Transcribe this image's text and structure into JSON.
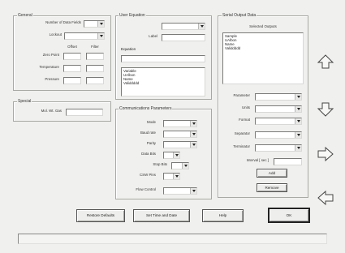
{
  "general": {
    "title": "General",
    "num_data_fields_label": "Number of Data Fields",
    "num_data_fields_value": "",
    "lockout_label": "Lockout",
    "lockout_value": "",
    "offset_header": "Offset",
    "filter_header": "Filter",
    "rows": [
      {
        "label": "Zero Point"
      },
      {
        "label": "Temperature"
      },
      {
        "label": "Pressure"
      }
    ]
  },
  "special": {
    "title": "Special",
    "mol_wt_label": "Mol. Wt. Gas",
    "mol_wt_value": ""
  },
  "user_equation": {
    "title": "User Equation",
    "label_label": "Label",
    "label_value": "",
    "equation_label": "Equation",
    "equation_value": "",
    "list_items": [
      "Variable",
      "UAlbon",
      "Name",
      "Validdddd"
    ]
  },
  "comm": {
    "title": "Communications Parameters",
    "fields": [
      {
        "label": "Mode"
      },
      {
        "label": "Baud rate"
      },
      {
        "label": "Parity"
      },
      {
        "label": "Data Bits"
      },
      {
        "label": "Stop Bits"
      },
      {
        "label": "CSW Pins"
      },
      {
        "label": "Flow Control"
      }
    ]
  },
  "serial_output": {
    "title": "Serial Output Data",
    "selected_outputs_label": "Selected Outputs",
    "selected_list": [
      "Sample",
      "UAlbon",
      "Name",
      "Validdddd"
    ],
    "params": [
      {
        "label": "Parameter"
      },
      {
        "label": "Units"
      },
      {
        "label": "Format"
      },
      {
        "label": "Separator"
      },
      {
        "label": "Terminator"
      }
    ],
    "interval_label": "Interval [ sec ]",
    "interval_value": "",
    "add_label": "Add",
    "remove_label": "Remove"
  },
  "arrows": [
    "up-arrow-icon",
    "down-arrow-icon",
    "right-arrow-icon",
    "left-arrow-icon"
  ],
  "footer": {
    "restore_defaults": "Restore Defaults",
    "set_time_date": "Set Time and Date",
    "help": "Help",
    "ok": "OK"
  },
  "status_text": ""
}
